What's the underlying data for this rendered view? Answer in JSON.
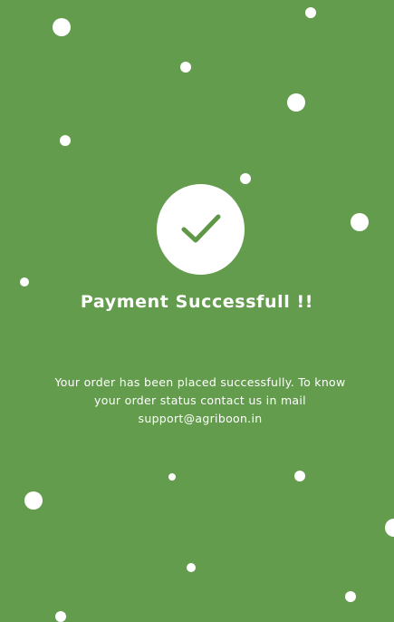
{
  "theme": {
    "background": "#639c4d",
    "accent": "#5e9745",
    "foreground": "#ffffff"
  },
  "success": {
    "icon": "checkmark-icon",
    "title": "Payment Successfull !!",
    "message_lines": [
      "Your order has been placed successfully. To know",
      "your order status contact us in mail",
      "support@agriboon.in"
    ]
  }
}
